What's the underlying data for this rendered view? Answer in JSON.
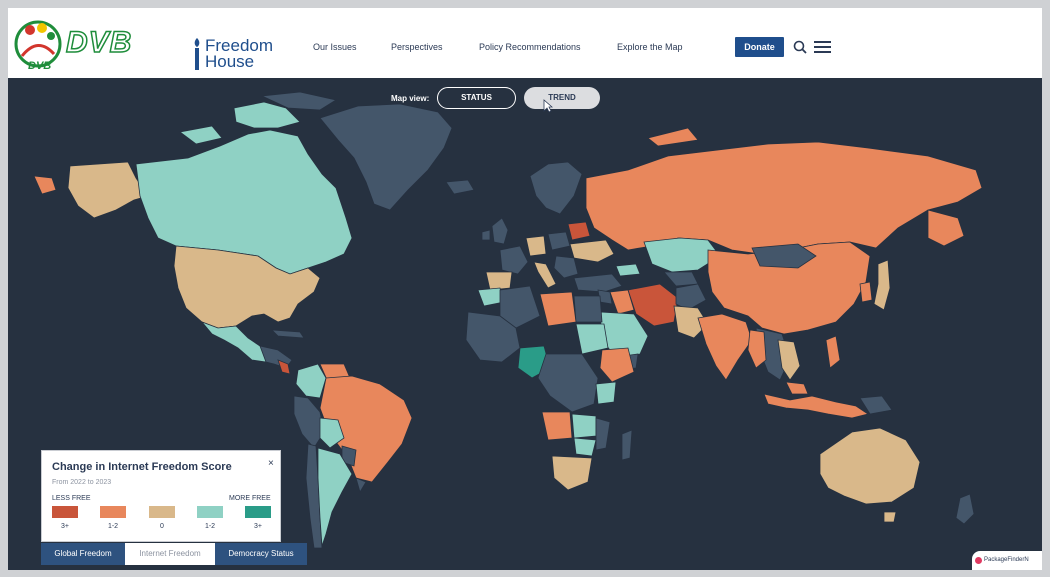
{
  "header": {
    "dvb_logo_text": "DVB",
    "dvb_logo_subtext": "DVB",
    "fh_logo_line1": "Freedom",
    "fh_logo_line2": "House",
    "nav": [
      "Our Issues",
      "Perspectives",
      "Policy Recommendations",
      "Explore the Map"
    ],
    "donate_label": "Donate",
    "search_icon": "search-icon",
    "menu_icon": "hamburger-menu-icon"
  },
  "map_controls": {
    "label": "Map view:",
    "status_label": "STATUS",
    "trend_label": "TREND",
    "active": "TREND"
  },
  "legend": {
    "title": "Change in Internet Freedom Score",
    "subtitle": "From 2022 to 2023",
    "close": "×",
    "less_free": "LESS FREE",
    "more_free": "MORE FREE",
    "items": [
      {
        "label": "3+",
        "color": "#c9553a"
      },
      {
        "label": "1-2",
        "color": "#e8875c"
      },
      {
        "label": "0",
        "color": "#d9b88a"
      },
      {
        "label": "1-2",
        "color": "#8fd1c4"
      },
      {
        "label": "3+",
        "color": "#2a9c88"
      }
    ]
  },
  "colors": {
    "no_data": "#44566a",
    "ocean": "#263140",
    "less_free_3": "#c9553a",
    "less_free_1_2": "#e8875c",
    "neutral": "#d9b88a",
    "more_free_1_2": "#8fd1c4",
    "more_free_3": "#2a9c88"
  },
  "bottom_tabs": [
    "Global Freedom",
    "Internet Freedom",
    "Democracy Status"
  ],
  "active_tab": "Internet Freedom",
  "badge": {
    "label": "PackageFinderN",
    "icon": "package-finder-icon"
  }
}
